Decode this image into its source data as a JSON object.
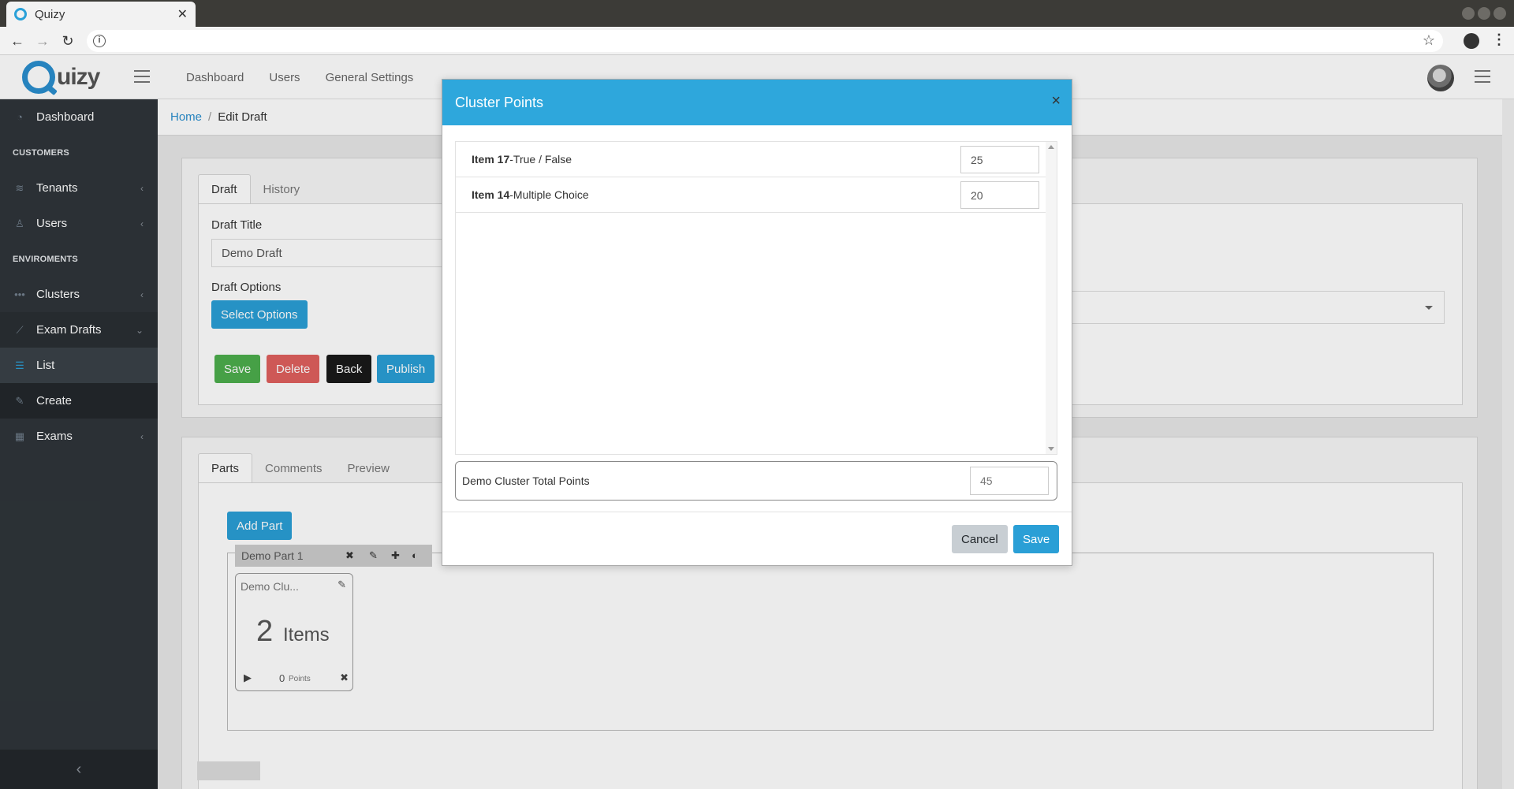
{
  "browser": {
    "tab_title": "Quizy",
    "close_glyph": "✕"
  },
  "app": {
    "logo_text": "uizy",
    "topnav": [
      "Dashboard",
      "Users",
      "General Settings"
    ]
  },
  "sidebar": {
    "dashboard": "Dashboard",
    "section_customers": "CUSTOMERS",
    "tenants": "Tenants",
    "users": "Users",
    "section_environments": "ENVIROMENTS",
    "clusters": "Clusters",
    "exam_drafts": "Exam Drafts",
    "list": "List",
    "create": "Create",
    "exams": "Exams",
    "collapse_glyph": "‹"
  },
  "breadcrumb": {
    "home": "Home",
    "separator": "/",
    "current": "Edit Draft"
  },
  "draft_card": {
    "tabs": [
      "Draft",
      "History"
    ],
    "title_label": "Draft Title",
    "title_value": "Demo Draft",
    "options_label": "Draft Options",
    "select_options_button": "Select Options",
    "buttons": {
      "save": "Save",
      "delete": "Delete",
      "back": "Back",
      "publish": "Publish"
    }
  },
  "parts_card": {
    "tabs": [
      "Parts",
      "Comments",
      "Preview"
    ],
    "add_part_button": "Add Part",
    "part": {
      "name": "Demo Part 1",
      "cluster": {
        "name": "Demo Clu...",
        "count": "2",
        "count_label": "Items",
        "points": "0",
        "points_label": "Points"
      }
    }
  },
  "modal": {
    "title": "Cluster Points",
    "close_glyph": "×",
    "items": [
      {
        "label_bold": "Item 17",
        "label_rest": "-True / False",
        "value": "25"
      },
      {
        "label_bold": "Item 14",
        "label_rest": "-Multiple Choice",
        "value": "20"
      }
    ],
    "total_label": "Demo Cluster Total Points",
    "total_value": "45",
    "cancel": "Cancel",
    "save": "Save"
  },
  "colors": {
    "brand": "#2ea7dc",
    "sidebar_bg": "#2f353a",
    "save_green": "#4cae4c",
    "delete_red": "#e0605e"
  }
}
